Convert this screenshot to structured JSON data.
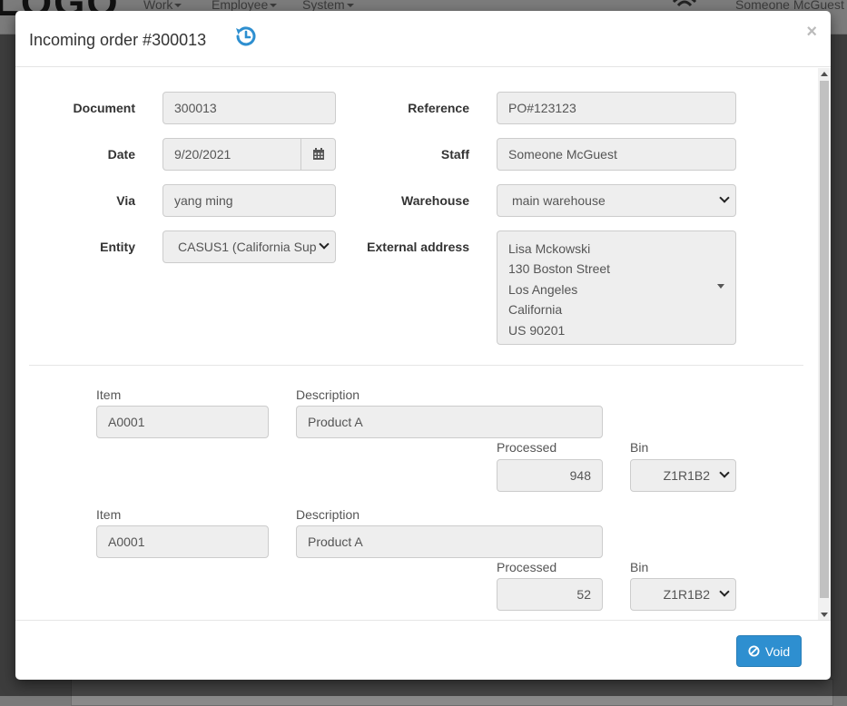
{
  "background": {
    "logo_text": "LOGO",
    "menu": [
      {
        "label": "Work"
      },
      {
        "label": "Employee"
      },
      {
        "label": "System"
      }
    ],
    "user_label": "Someone McGuest"
  },
  "modal": {
    "title": "Incoming order #300013",
    "close_label": "×",
    "icons": {
      "history": "history-icon",
      "calendar": "calendar-icon",
      "close": "close-icon",
      "void": "ban-icon"
    },
    "colors": {
      "accent": "#2e8fd0",
      "history_icon": "#2e8fd0"
    }
  },
  "form": {
    "document": {
      "label": "Document",
      "value": "300013"
    },
    "reference": {
      "label": "Reference",
      "value": "PO#123123"
    },
    "date": {
      "label": "Date",
      "value": "9/20/2021"
    },
    "staff": {
      "label": "Staff",
      "value": "Someone McGuest"
    },
    "via": {
      "label": "Via",
      "value": "yang ming"
    },
    "warehouse": {
      "label": "Warehouse",
      "value": "main warehouse"
    },
    "entity": {
      "label": "Entity",
      "value": "CASUS1 (California Sup"
    },
    "external_address": {
      "label": "External address",
      "lines": [
        "Lisa Mckowski",
        "130 Boston Street",
        "Los Angeles",
        "California",
        "US 90201"
      ]
    }
  },
  "lines": [
    {
      "item_label": "Item",
      "item": "A0001",
      "description_label": "Description",
      "description": "Product A",
      "processed_label": "Processed",
      "processed": "948",
      "bin_label": "Bin",
      "bin": "Z1R1B2"
    },
    {
      "item_label": "Item",
      "item": "A0001",
      "description_label": "Description",
      "description": "Product A",
      "processed_label": "Processed",
      "processed": "52",
      "bin_label": "Bin",
      "bin": "Z1R1B2"
    }
  ],
  "footer": {
    "void_label": "Void"
  }
}
